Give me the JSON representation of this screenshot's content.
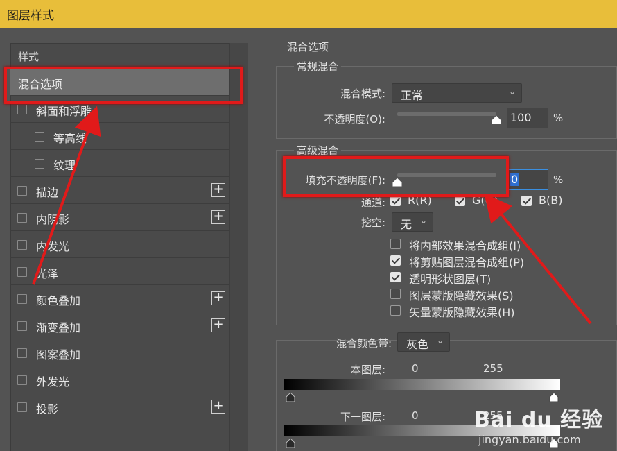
{
  "window": {
    "title": "图层样式"
  },
  "styles_list": {
    "header": "样式",
    "items": [
      {
        "label": "混合选项",
        "checkbox": false,
        "plus": false,
        "selected": true
      },
      {
        "label": "斜面和浮雕",
        "checkbox": true,
        "plus": false
      },
      {
        "label": "等高线",
        "checkbox": true,
        "plus": false,
        "indent": true
      },
      {
        "label": "纹理",
        "checkbox": true,
        "plus": false,
        "indent": true
      },
      {
        "label": "描边",
        "checkbox": true,
        "plus": true
      },
      {
        "label": "内阴影",
        "checkbox": true,
        "plus": true
      },
      {
        "label": "内发光",
        "checkbox": true,
        "plus": false
      },
      {
        "label": "光泽",
        "checkbox": true,
        "plus": false
      },
      {
        "label": "颜色叠加",
        "checkbox": true,
        "plus": true
      },
      {
        "label": "渐变叠加",
        "checkbox": true,
        "plus": true
      },
      {
        "label": "图案叠加",
        "checkbox": true,
        "plus": false
      },
      {
        "label": "外发光",
        "checkbox": true,
        "plus": false
      },
      {
        "label": "投影",
        "checkbox": true,
        "plus": true
      }
    ],
    "plus_symbol": "+"
  },
  "blend_options": {
    "title": "混合选项",
    "general": {
      "title": "常规混合",
      "mode_label": "混合模式:",
      "mode_value": "正常",
      "opacity_label": "不透明度(O):",
      "opacity_value": "100",
      "opacity_level": 1.0,
      "unit": "%"
    },
    "advanced": {
      "title": "高级混合",
      "fill_label": "填充不透明度(F):",
      "fill_value": "0",
      "fill_level": 0.0,
      "unit": "%",
      "channels_label": "通道:",
      "channels": [
        {
          "label": "R(R)",
          "checked": true
        },
        {
          "label": "G(G)",
          "checked": true
        },
        {
          "label": "B(B)",
          "checked": true
        }
      ],
      "knockout_label": "挖空:",
      "knockout_value": "无",
      "options": [
        {
          "label": "将内部效果混合成组(I)",
          "checked": false
        },
        {
          "label": "将剪贴图层混合成组(P)",
          "checked": true
        },
        {
          "label": "透明形状图层(T)",
          "checked": true
        },
        {
          "label": "图层蒙版隐藏效果(S)",
          "checked": false
        },
        {
          "label": "矢量蒙版隐藏效果(H)",
          "checked": false
        }
      ]
    },
    "blend_if": {
      "label": "混合颜色带:",
      "value": "灰色",
      "this_layer_label": "本图层:",
      "this_layer_min": "0",
      "this_layer_max": "255",
      "underlying_label": "下一图层:",
      "underlying_min": "0",
      "underlying_max": "255"
    }
  },
  "watermark": {
    "brand": "Bai du 经验",
    "sub": "jingyan.baidu.com"
  },
  "colors": {
    "titlebar": "#e8be3a",
    "annotation_red": "#e11a1a",
    "panel_bg": "#535353"
  }
}
